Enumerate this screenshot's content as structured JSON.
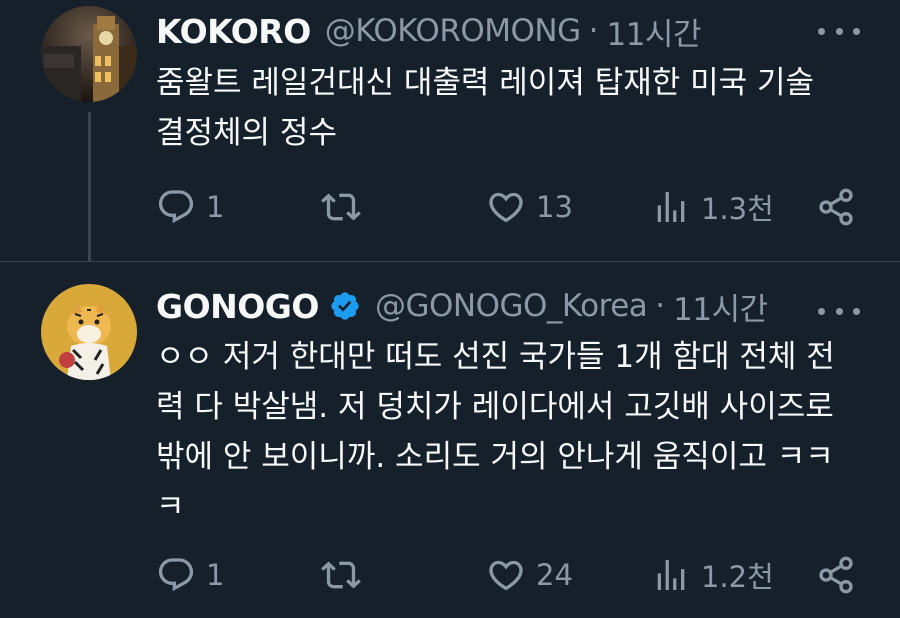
{
  "tweets": [
    {
      "author_name": "KOKORO",
      "handle": "@KOKOROMONG",
      "separator": "·",
      "time": "11시간",
      "lines": [
        "줌왈트 레일건대신 대출력 레이져 탑재한 미국 기술",
        "결정체의 정수"
      ],
      "replies": "1",
      "retweets": "",
      "likes": "13",
      "views": "1.3천",
      "verified": false
    },
    {
      "author_name": "GONOGO",
      "handle": "@GONOGO_Korea",
      "separator": "·",
      "time": "11시간",
      "lines": [
        "ㅇㅇ 저거 한대만 떠도 선진 국가들 1개 함대 전체 전",
        "력 다 박살냄.  저 덩치가 레이다에서 고깃배 사이즈로",
        "밖에 안 보이니까.  소리도 거의 안나게 움직이고 ㅋㅋ",
        "ㅋ"
      ],
      "replies": "1",
      "retweets": "",
      "likes": "24",
      "views": "1.2천",
      "verified": true
    }
  ],
  "icons": {
    "reply": "reply-icon",
    "retweet": "retweet-icon",
    "like": "heart-icon",
    "views": "views-icon",
    "share": "share-icon",
    "more": "more-icon",
    "verified": "verified-badge-icon"
  },
  "colors": {
    "background": "#15202b",
    "text": "#f7f9f9",
    "secondary": "#8b98a5",
    "verified": "#1d9bf0",
    "divider": "#38444d"
  }
}
